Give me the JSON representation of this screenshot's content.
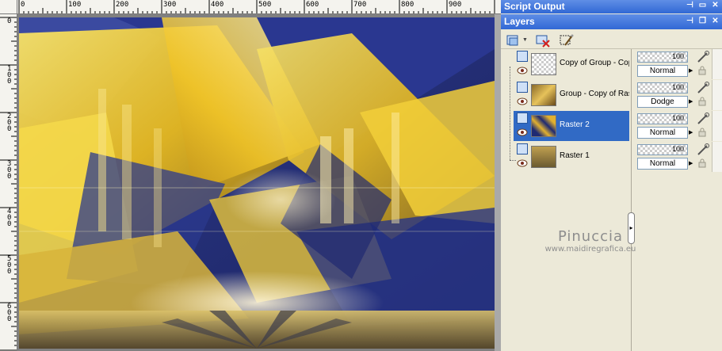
{
  "panels": {
    "script_output": {
      "title": "Script Output"
    },
    "layers": {
      "title": "Layers"
    }
  },
  "ruler": {
    "top_labels": [
      "0",
      "100",
      "200",
      "300",
      "400",
      "500",
      "600",
      "700",
      "800",
      "900"
    ],
    "left_labels": [
      "0",
      "100",
      "200",
      "300",
      "400",
      "500",
      "600"
    ]
  },
  "layers": [
    {
      "name": "Copy of Group - Cop",
      "opacity": "100",
      "blend_mode": "Normal",
      "selected": false,
      "is_group": true
    },
    {
      "name": "Group - Copy of Rast",
      "opacity": "100",
      "blend_mode": "Dodge",
      "selected": false,
      "is_group": true
    },
    {
      "name": "Raster 2",
      "opacity": "100",
      "blend_mode": "Normal",
      "selected": true,
      "is_group": false
    },
    {
      "name": "Raster 1",
      "opacity": "100",
      "blend_mode": "Normal",
      "selected": false,
      "is_group": false
    }
  ],
  "watermark": {
    "name": "Pinuccia",
    "url": "www.maidiregrafica.eu"
  },
  "icons": {
    "new_layer": "new-layer-icon",
    "delete_layer": "delete-layer-icon",
    "layer_properties": "layer-properties-icon",
    "visibility": "eye-icon",
    "brush": "brush-icon",
    "lock": "lock-icon"
  },
  "colors": {
    "titlebar": "#3168d5",
    "selection": "#316ac5",
    "panel_bg": "#ece9d8"
  }
}
